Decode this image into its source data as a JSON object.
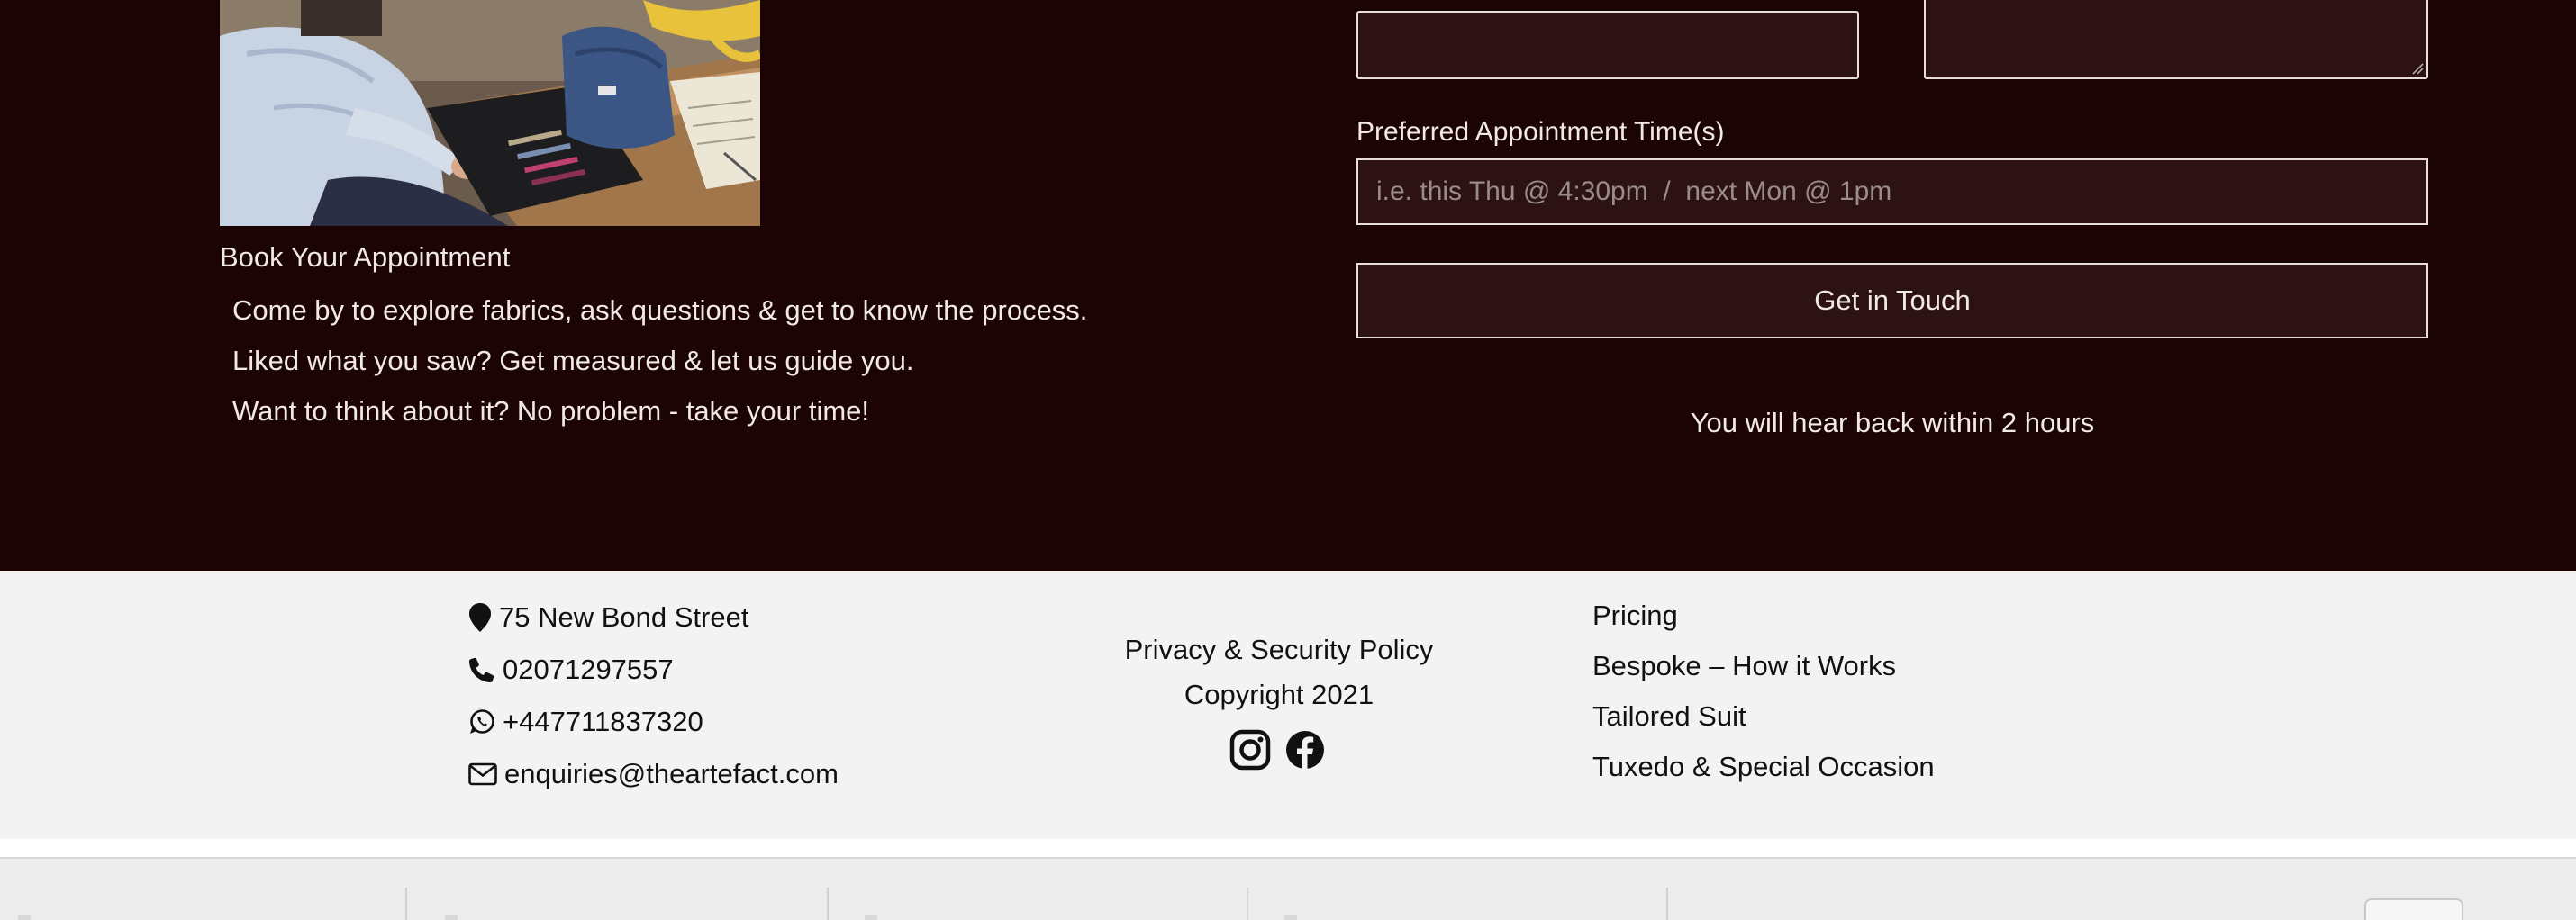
{
  "appointment": {
    "title": "Book Your Appointment",
    "lines": [
      "Come by to explore fabrics, ask questions & get to know the process.",
      "Liked what you saw? Get measured & let us guide you.",
      "Want to think about it? No problem - take your time!"
    ]
  },
  "form": {
    "preferred_time_label": "Preferred Appointment Time(s)",
    "preferred_time_placeholder": "i.e. this Thu @ 4:30pm  /  next Mon @ 1pm",
    "submit_label": "Get in Touch",
    "reply_note": "You will hear back within 2 hours"
  },
  "footer": {
    "address": "75 New Bond Street",
    "phone": "02071297557",
    "whatsapp": "+447711837320",
    "email": "enquiries@theartefact.com",
    "privacy": "Privacy & Security Policy",
    "copyright": "Copyright 2021",
    "links": [
      "Pricing",
      "Bespoke – How it Works",
      "Tailored Suit",
      "Tuxedo & Special Occasion"
    ],
    "social_icons": [
      "instagram-icon",
      "facebook-icon"
    ]
  },
  "colors": {
    "dark_background": "#1c0405",
    "field_background": "#2c1213",
    "footer_background": "#f3f3f3"
  }
}
